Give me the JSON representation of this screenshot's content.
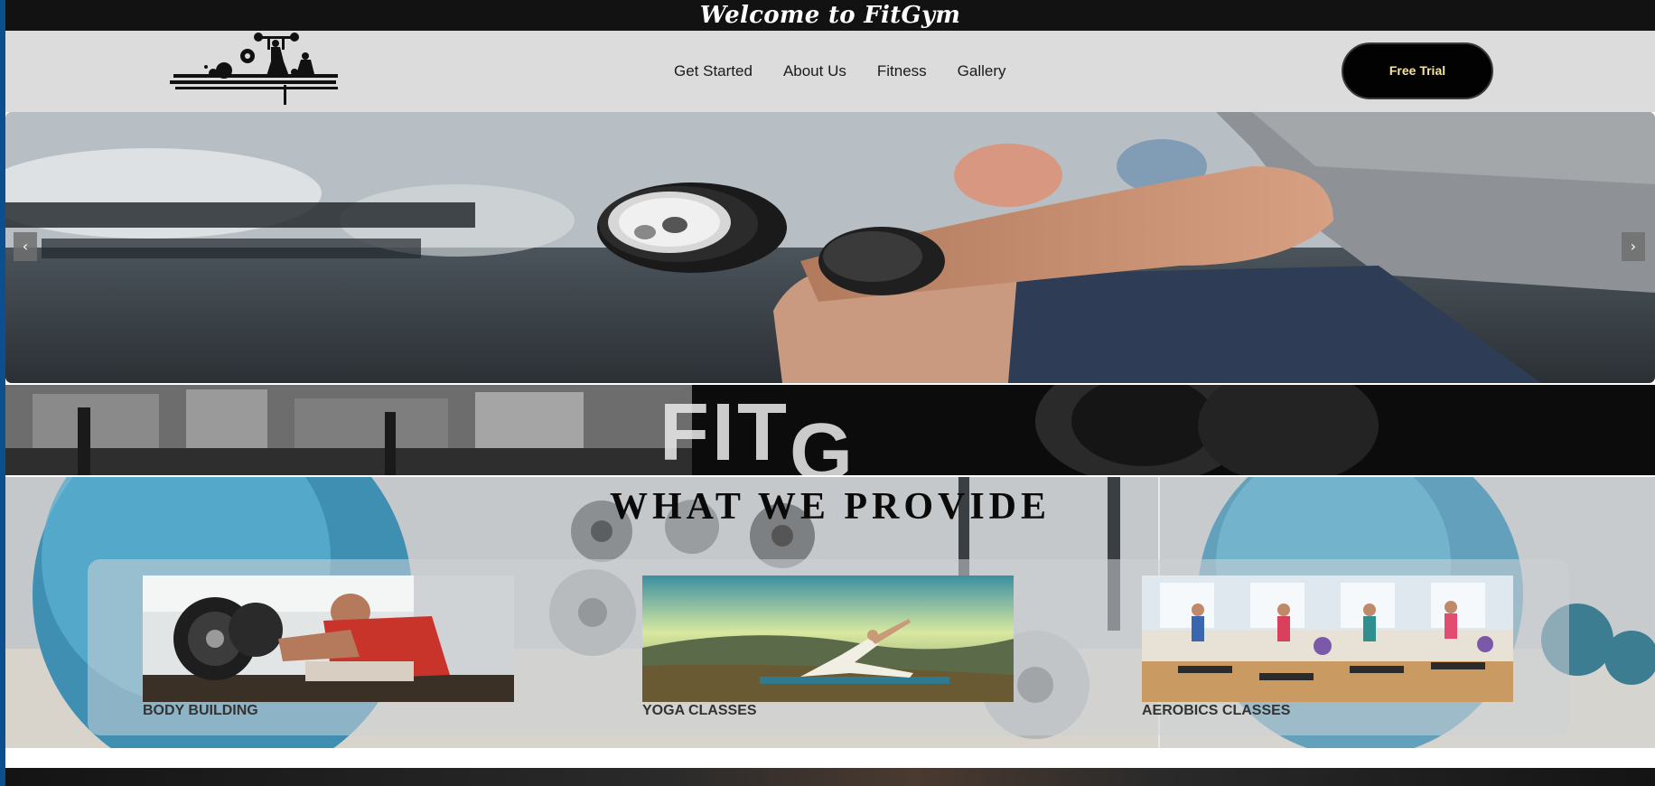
{
  "header": {
    "welcome": "Welcome to FitGym"
  },
  "nav": {
    "logo_icon": "gym-silhouette-logo",
    "links": [
      "Get Started",
      "About Us",
      "Fitness",
      "Gallery"
    ],
    "cta_label": "Free Trial"
  },
  "hero": {
    "prev_arrow": "‹",
    "next_arrow": "›",
    "image": "man-lifting-dumbbell-in-gym"
  },
  "brand_strip": {
    "letters_main": "FIT",
    "letters_drop": "G"
  },
  "services": {
    "title": "WHAT WE PROVIDE",
    "items": [
      {
        "label": "BODY BUILDING",
        "image": "man-curling-weights"
      },
      {
        "label": "YOGA CLASSES",
        "image": "woman-yoga-on-hill"
      },
      {
        "label": "AEROBICS CLASSES",
        "image": "aerobics-step-class"
      }
    ]
  },
  "colors": {
    "top_bar": "#121212",
    "nav_bg": "#dcdcdc",
    "cta_bg": "#020202",
    "cta_text": "#f4e3a3",
    "page_edge": "#0b4f8f"
  }
}
